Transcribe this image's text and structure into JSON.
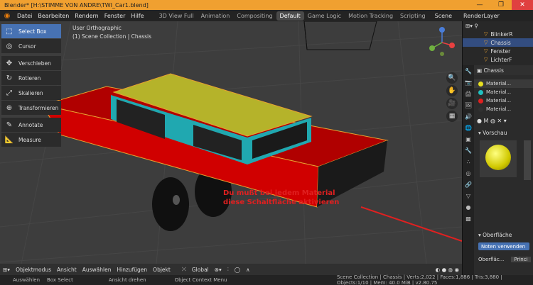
{
  "window": {
    "title": "Blender* [H:\\STIMME VON ANDRE\\TWI_Car1.blend]",
    "minimize": "—",
    "maximize": "❐",
    "close": "✕"
  },
  "menu": {
    "items": [
      "Datei",
      "Bearbeiten",
      "Rendern",
      "Fenster",
      "Hilfe"
    ]
  },
  "workspaces": [
    {
      "label": "3D View Full",
      "active": false
    },
    {
      "label": "Animation",
      "active": false
    },
    {
      "label": "Compositing",
      "active": false
    },
    {
      "label": "Default",
      "active": true
    },
    {
      "label": "Game Logic",
      "active": false
    },
    {
      "label": "Motion Tracking",
      "active": false
    },
    {
      "label": "Scripting",
      "active": false
    }
  ],
  "scene": "Scene",
  "view_layer": "RenderLayer",
  "tools": [
    {
      "label": "Select Box",
      "icon": "select-box-icon",
      "active": true
    },
    {
      "label": "Cursor",
      "icon": "cursor-icon",
      "active": false
    },
    {
      "label": "Verschieben",
      "icon": "move-icon",
      "active": false
    },
    {
      "label": "Rotieren",
      "icon": "rotate-icon",
      "active": false
    },
    {
      "label": "Skalieren",
      "icon": "scale-icon",
      "active": false
    },
    {
      "label": "Transformieren",
      "icon": "transform-icon",
      "active": false
    },
    {
      "label": "Annotate",
      "icon": "annotate-icon",
      "active": false
    },
    {
      "label": "Measure",
      "icon": "measure-icon",
      "active": false
    }
  ],
  "viewport": {
    "view": "User Orthographic",
    "collection": "(1) Scene Collection | Chassis"
  },
  "annotation": {
    "line1": "Du mußt bei jedem Material",
    "line2": "diese Schaltfläche aktivieren",
    "color": "#e02020"
  },
  "viewport_header": {
    "mode": "Objektmodus",
    "items": [
      "Ansicht",
      "Auswählen",
      "Hinzufügen",
      "Objekt"
    ],
    "orientation": "Global"
  },
  "outliner": {
    "rows": [
      {
        "label": "BlinkerR",
        "selected": false
      },
      {
        "label": "Chassis",
        "selected": true
      },
      {
        "label": "Fenster",
        "selected": false
      },
      {
        "label": "LichterF",
        "selected": false
      }
    ]
  },
  "properties": {
    "object": "Chassis",
    "materials": [
      {
        "label": "Material...",
        "color": "#e8e020",
        "selected": true
      },
      {
        "label": "Material...",
        "color": "#20c0c0",
        "selected": false
      },
      {
        "label": "Material...",
        "color": "#e02020",
        "selected": false
      },
      {
        "label": "Material...",
        "color": "#303030",
        "selected": false
      }
    ],
    "preview_section": "Vorschau",
    "surface_section": "Oberfläche",
    "use_nodes_button": "Noten verwenden",
    "surface_label": "Oberfläc...",
    "surface_value": "Princi"
  },
  "status": {
    "left": [
      "Auswählen",
      "Box Select",
      "Ansicht drehen",
      "Object Context Menu"
    ],
    "stats": "Scene Collection | Chassis | Verts:2,022 | Faces:1,886 | Tris:3,880 | Objects:1/10 | Mem: 40.0 MiB | v2.80.75"
  },
  "colors": {
    "accent": "#4772b3",
    "titlebar": "#f0a030",
    "car_body": "#d00000",
    "car_roof": "#b5b32a",
    "window_frame": "#20a8b0"
  }
}
